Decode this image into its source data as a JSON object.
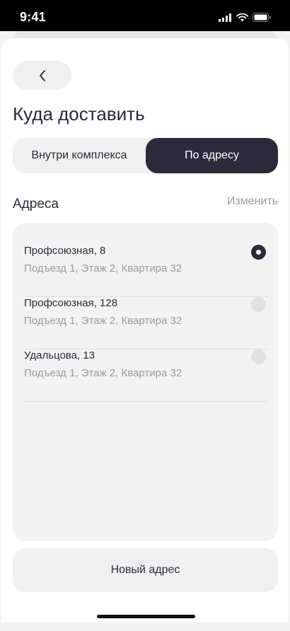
{
  "status_bar": {
    "time": "9:41"
  },
  "header": {
    "title": "Куда доставить"
  },
  "delivery_mode": {
    "options": [
      {
        "label": "Внутри комплекса",
        "selected": false
      },
      {
        "label": "По адресу",
        "selected": true
      }
    ]
  },
  "addresses": {
    "title": "Адреса",
    "edit_label": "Изменить",
    "items": [
      {
        "name": "Профсоюзная, 8",
        "details": "Подъезд 1, Этаж 2, Квартира 32",
        "selected": true
      },
      {
        "name": "Профсоюзная, 128",
        "details": "Подъезд 1, Этаж 2, Квартира 32",
        "selected": false
      },
      {
        "name": "Удальцова, 13",
        "details": "Подъезд 1, Этаж 2, Квартира 32",
        "selected": false
      }
    ]
  },
  "new_address_label": "Новый адрес",
  "colors": {
    "accent_dark": "#2c2a3a",
    "muted_text": "#9a99a1",
    "surface": "#f3f3f4"
  },
  "icons": {
    "back": "chevron-left-icon",
    "signal": "signal-icon",
    "wifi": "wifi-icon",
    "battery": "battery-icon"
  }
}
